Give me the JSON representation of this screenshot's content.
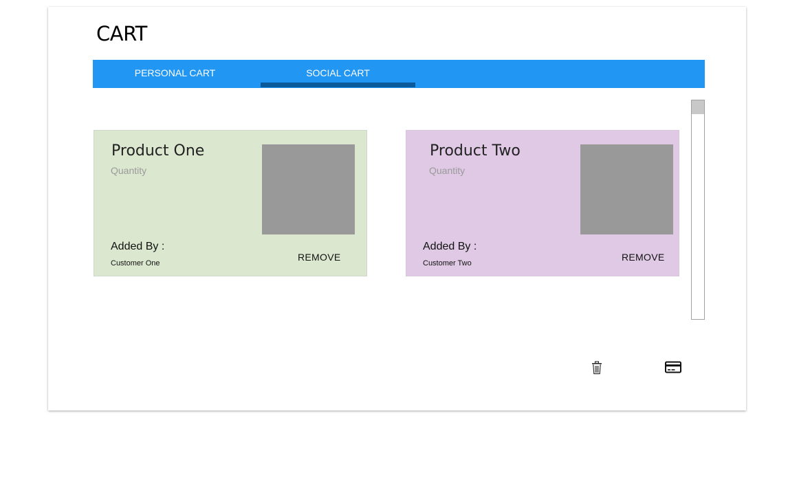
{
  "page": {
    "title": "CART"
  },
  "tabs": [
    {
      "label": "PERSONAL CART",
      "selected": false
    },
    {
      "label": "SOCIAL CART",
      "selected": true
    }
  ],
  "colors": {
    "tabbar": "#2196f3",
    "tab_indicator": "#0a5a9c",
    "card_one": "#dbe7cf",
    "card_two": "#dfc9e4"
  },
  "products": [
    {
      "name": "Product One",
      "quantity_label": "Quantity",
      "added_by_label": "Added By :",
      "customer": "Customer One",
      "remove_label": "REMOVE"
    },
    {
      "name": "Product Two",
      "quantity_label": "Quantity",
      "added_by_label": "Added By :",
      "customer": "Customer Two",
      "remove_label": "REMOVE"
    }
  ],
  "actions": {
    "delete_icon": "trash-icon",
    "pay_icon": "credit-card-icon"
  }
}
